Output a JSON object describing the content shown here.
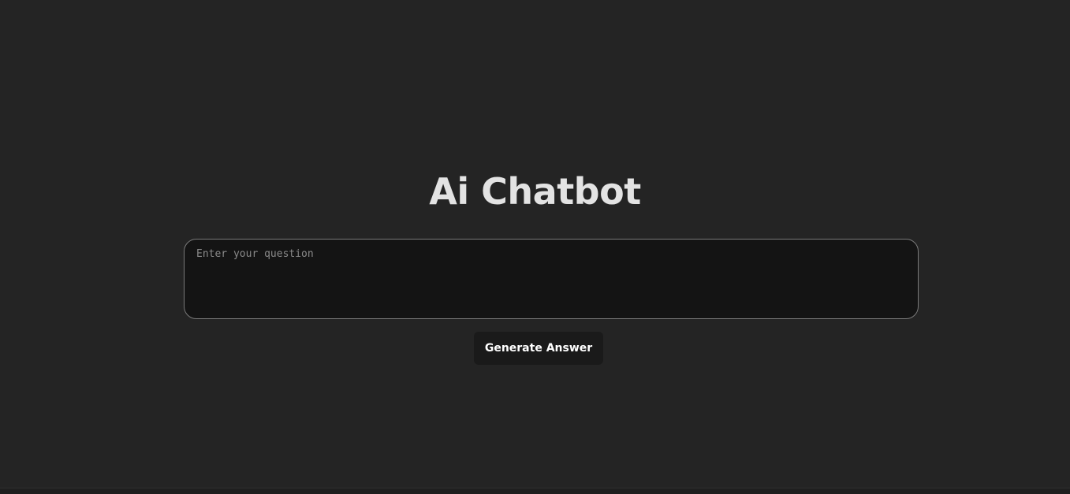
{
  "app": {
    "title": "Ai Chatbot"
  },
  "question": {
    "placeholder": "Enter your question",
    "value": ""
  },
  "actions": {
    "generate_label": "Generate Answer"
  },
  "colors": {
    "background": "#242424",
    "input_background": "#141414",
    "input_border": "#7a7a7a",
    "title_text": "#e3e3e3",
    "button_background": "#1a1a1a",
    "button_text": "#ffffff"
  }
}
